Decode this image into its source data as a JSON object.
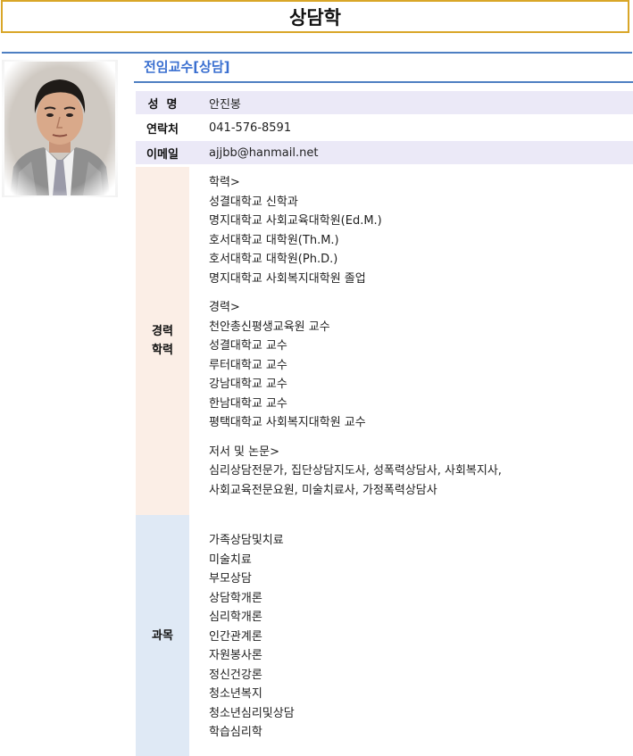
{
  "header": {
    "title": "상담학"
  },
  "section": {
    "title": "전임교수[상담]"
  },
  "info": [
    {
      "label": "성  명",
      "value": "안진봉"
    },
    {
      "label": "연락처",
      "value": "041-576-8591"
    },
    {
      "label": "이메일",
      "value": "ajjbb@hanmail.net"
    }
  ],
  "career": {
    "label_line1": "경력",
    "label_line2": "학력",
    "groups": [
      {
        "heading": "학력>",
        "items": [
          "성결대학교 신학과",
          "명지대학교 사회교육대학원(Ed.M.)",
          "호서대학교 대학원(Th.M.)",
          "호서대학교 대학원(Ph.D.)",
          "명지대학교 사회복지대학원 졸업"
        ]
      },
      {
        "heading": "경력>",
        "items": [
          "천안총신평생교육원 교수",
          "성결대학교 교수",
          "루터대학교 교수",
          "강남대학교 교수",
          "한남대학교 교수",
          "평택대학교 사회복지대학원 교수"
        ]
      },
      {
        "heading": "저서 및 논문>",
        "items": [
          "심리상담전문가, 집단상담지도사, 성폭력상담사, 사회복지사,",
          "사회교육전문요원, 미술치료사, 가정폭력상담사"
        ]
      }
    ]
  },
  "subjects": {
    "label": "과목",
    "items": [
      "가족상담및치료",
      "미술치료",
      "부모상담",
      "상담학개론",
      "심리학개론",
      "인간관계론",
      "자원봉사론",
      "정신건강론",
      "청소년복지",
      "청소년심리및상담",
      "학습심리학"
    ]
  },
  "photo": {
    "icon": "person-portrait",
    "colors": {
      "jacket": "#8a8a8a",
      "skin": "#d9a98a",
      "hair": "#1f1b18",
      "tie": "#9a9aa8"
    }
  },
  "colors": {
    "title_border": "#d9a628",
    "rule": "#4e7fc2",
    "section_title": "#3a6fd0",
    "info_bg": "#ebe9f7",
    "career_bg": "#fbeee6",
    "subject_bg": "#dfe9f5"
  }
}
